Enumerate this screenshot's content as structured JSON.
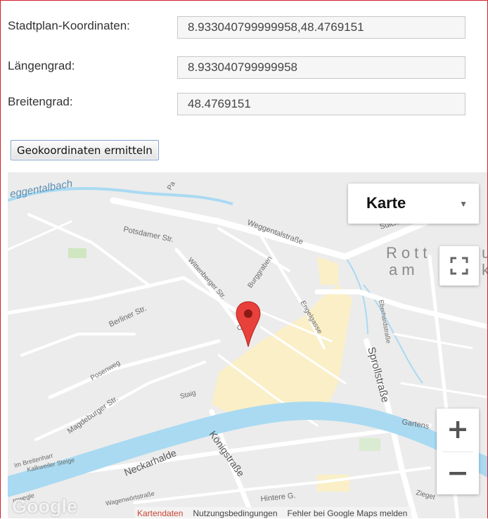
{
  "form": {
    "coords_label": "Stadtplan-Koordinaten:",
    "coords_value": "8.933040799999958,48.4769151",
    "lng_label": "Längengrad:",
    "lng_value": "8.933040799999958",
    "lat_label": "Breitengrad:",
    "lat_value": "48.4769151",
    "button_label": "Geokoordinaten ermitteln"
  },
  "map": {
    "map_type": "Karte",
    "zoom_in": "+",
    "zoom_out": "−",
    "logo": "Google",
    "attribution": {
      "data": "Kartendaten",
      "terms": "Nutzungsbedingungen",
      "report": "Fehler bei Google Maps melden"
    },
    "street_labels": {
      "eggentalbach": "eggentalbach",
      "potsdamer": "Potsdamer Str.",
      "weggentalstrasse": "Weggentalstraße",
      "wittenberger": "Wittenberger Str.",
      "burggraben": "Burggraben",
      "engelgasse": "Engelgasse",
      "berliner": "Berliner Str.",
      "posenweg": "Posenweg",
      "magdeburger": "Magdeburger Str.",
      "staig": "Staig",
      "eberhardstrasse": "Eberhardstraße",
      "sprollstrasse": "Sprollstraße",
      "gartenstr": "Gartens",
      "koenigstrasse": "Königstraße",
      "neckarhalde": "Neckarhalde",
      "breitenharr": "Im Breitenharr",
      "kalkweiler": "Kalkweiler Steige",
      "rowegle": "rowegle",
      "wagenwort": "Wagenwörtstraße",
      "hintere": "Hintere G.",
      "ziegel": "Zieget",
      "rottenburg": "Rott",
      "am": "am",
      "sulch": "Sülch",
      "pa": "Pa",
      "o": "O",
      "u": "u",
      "k": "k"
    },
    "colors": {
      "river": "#a9daf2",
      "oldtown": "#faefc6",
      "roads": "#ffffff",
      "background": "#ececec",
      "pin": "#e8403b"
    }
  }
}
